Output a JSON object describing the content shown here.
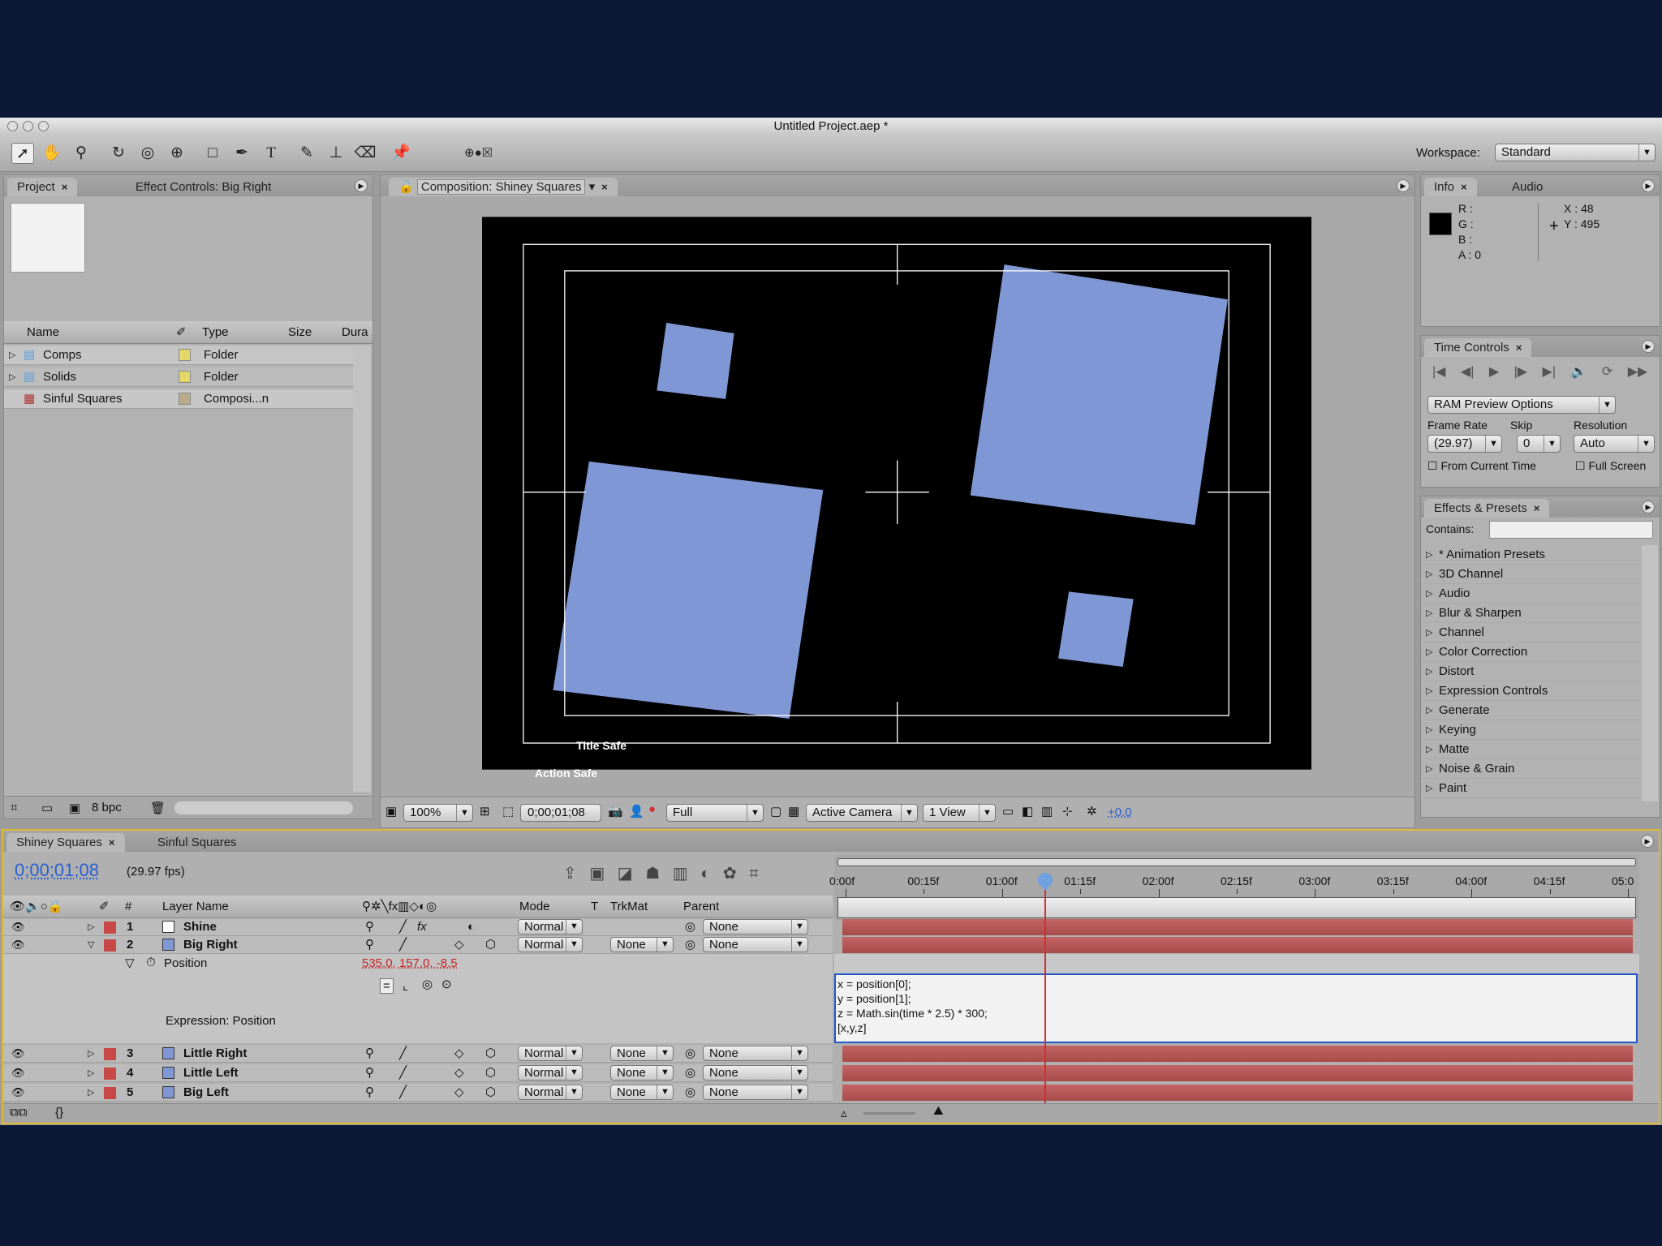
{
  "window": {
    "title": "Untitled Project.aep *"
  },
  "workspace": {
    "label": "Workspace:",
    "value": "Standard"
  },
  "project": {
    "tabs": [
      {
        "label": "Project"
      },
      {
        "label": "Effect Controls: Big Right"
      }
    ],
    "columns": [
      "Name",
      "Type",
      "Size",
      "Dura"
    ],
    "items": [
      {
        "name": "Comps",
        "type": "Folder",
        "label_color": "#e3d76a"
      },
      {
        "name": "Solids",
        "type": "Folder",
        "label_color": "#e3d76a"
      },
      {
        "name": "Sinful Squares",
        "type": "Composi...n",
        "label_color": "#b9ab8a"
      }
    ],
    "bpc": "8 bpc"
  },
  "composition": {
    "tab": "Composition: Shiney Squares",
    "title_safe": "Title Safe",
    "action_safe": "Action Safe",
    "zoom": "100%",
    "timecode": "0;00;01;08",
    "resolution": "Full",
    "camera": "Active Camera",
    "views": "1 View",
    "exposure": "+0.0",
    "square_color": "#7f97d4"
  },
  "info": {
    "tabs": [
      "Info",
      "Audio"
    ],
    "r": "R :",
    "g": "G :",
    "b": "B :",
    "a": "A : 0",
    "x": "X : 48",
    "y": "Y : 495"
  },
  "time_controls": {
    "tab": "Time Controls",
    "ram_preview": "RAM Preview Options",
    "frame_rate_label": "Frame Rate",
    "frame_rate": "(29.97)",
    "skip_label": "Skip",
    "skip": "0",
    "resolution_label": "Resolution",
    "resolution": "Auto",
    "from_current": "From Current Time",
    "full_screen": "Full Screen"
  },
  "effects": {
    "tab": "Effects & Presets",
    "contains_label": "Contains:",
    "contains_value": "",
    "items": [
      "* Animation Presets",
      "3D Channel",
      "Audio",
      "Blur & Sharpen",
      "Channel",
      "Color Correction",
      "Distort",
      "Expression Controls",
      "Generate",
      "Keying",
      "Matte",
      "Noise & Grain",
      "Paint"
    ]
  },
  "timeline": {
    "tabs": [
      "Shiney Squares",
      "Sinful Squares"
    ],
    "timecode": "0;00;01;08",
    "fps": "(29.97 fps)",
    "columns": {
      "num": "#",
      "layer_name": "Layer Name",
      "mode": "Mode",
      "t": "T",
      "trkmat": "TrkMat",
      "parent": "Parent"
    },
    "ruler": [
      "0:00f",
      "00:15f",
      "01:00f",
      "01:15f",
      "02:00f",
      "02:15f",
      "03:00f",
      "03:15f",
      "04:00f",
      "04:15f",
      "05:0"
    ],
    "playhead_seconds": 1.27,
    "duration_seconds": 5,
    "layers": [
      {
        "num": "1",
        "name": "Shine",
        "swatch": "#ffffff",
        "mode": "Normal",
        "trkmat": "",
        "parent": "None",
        "expanded": false
      },
      {
        "num": "2",
        "name": "Big Right",
        "swatch": "#7f97d4",
        "mode": "Normal",
        "trkmat": "None",
        "parent": "None",
        "expanded": true
      },
      {
        "num": "3",
        "name": "Little Right",
        "swatch": "#7f97d4",
        "mode": "Normal",
        "trkmat": "None",
        "parent": "None",
        "expanded": false
      },
      {
        "num": "4",
        "name": "Little Left",
        "swatch": "#7f97d4",
        "mode": "Normal",
        "trkmat": "None",
        "parent": "None",
        "expanded": false
      },
      {
        "num": "5",
        "name": "Big Left",
        "swatch": "#7f97d4",
        "mode": "Normal",
        "trkmat": "None",
        "parent": "None",
        "expanded": false
      }
    ],
    "property": {
      "name": "Position",
      "value": "535.0, 157.0, -8.5",
      "expression_label": "Expression: Position"
    },
    "expression_lines": [
      "x = position[0];",
      "y = position[1];",
      "z = Math.sin(time * 2.5) * 300;",
      "[x,y,z]"
    ]
  }
}
